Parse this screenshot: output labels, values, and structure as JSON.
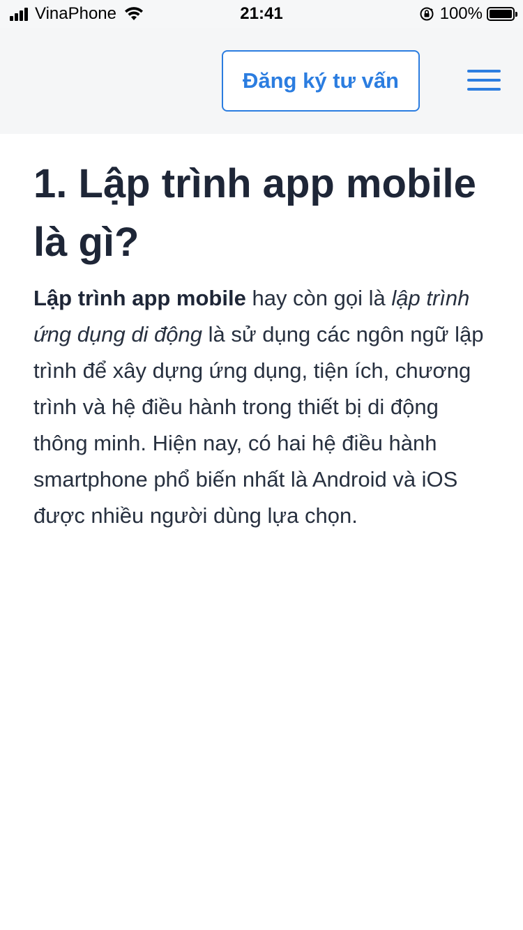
{
  "status_bar": {
    "carrier": "VinaPhone",
    "time": "21:41",
    "battery_percent": "100%",
    "battery_level": 1.0
  },
  "header": {
    "cta_label": "Đăng ký tư vấn",
    "menu_icon": "hamburger-menu-icon",
    "accent_color": "#2b7de0"
  },
  "article": {
    "heading": "1. Lập trình app mobile là gì?",
    "intro_bold": "Lập trình app mobile",
    "intro_text_1": " hay còn gọi là ",
    "intro_italic": "lập trình ứng dụng di động",
    "intro_text_2": " là sử dụng các ngôn ngữ lập trình để xây dựng ứng dụng, tiện ích, chương trình và hệ điều hành trong thiết bị di động thông minh.  Hiện nay, có hai hệ điều hành smartphone phổ biến nhất là Android và iOS được nhiều người dùng lựa chọn."
  }
}
